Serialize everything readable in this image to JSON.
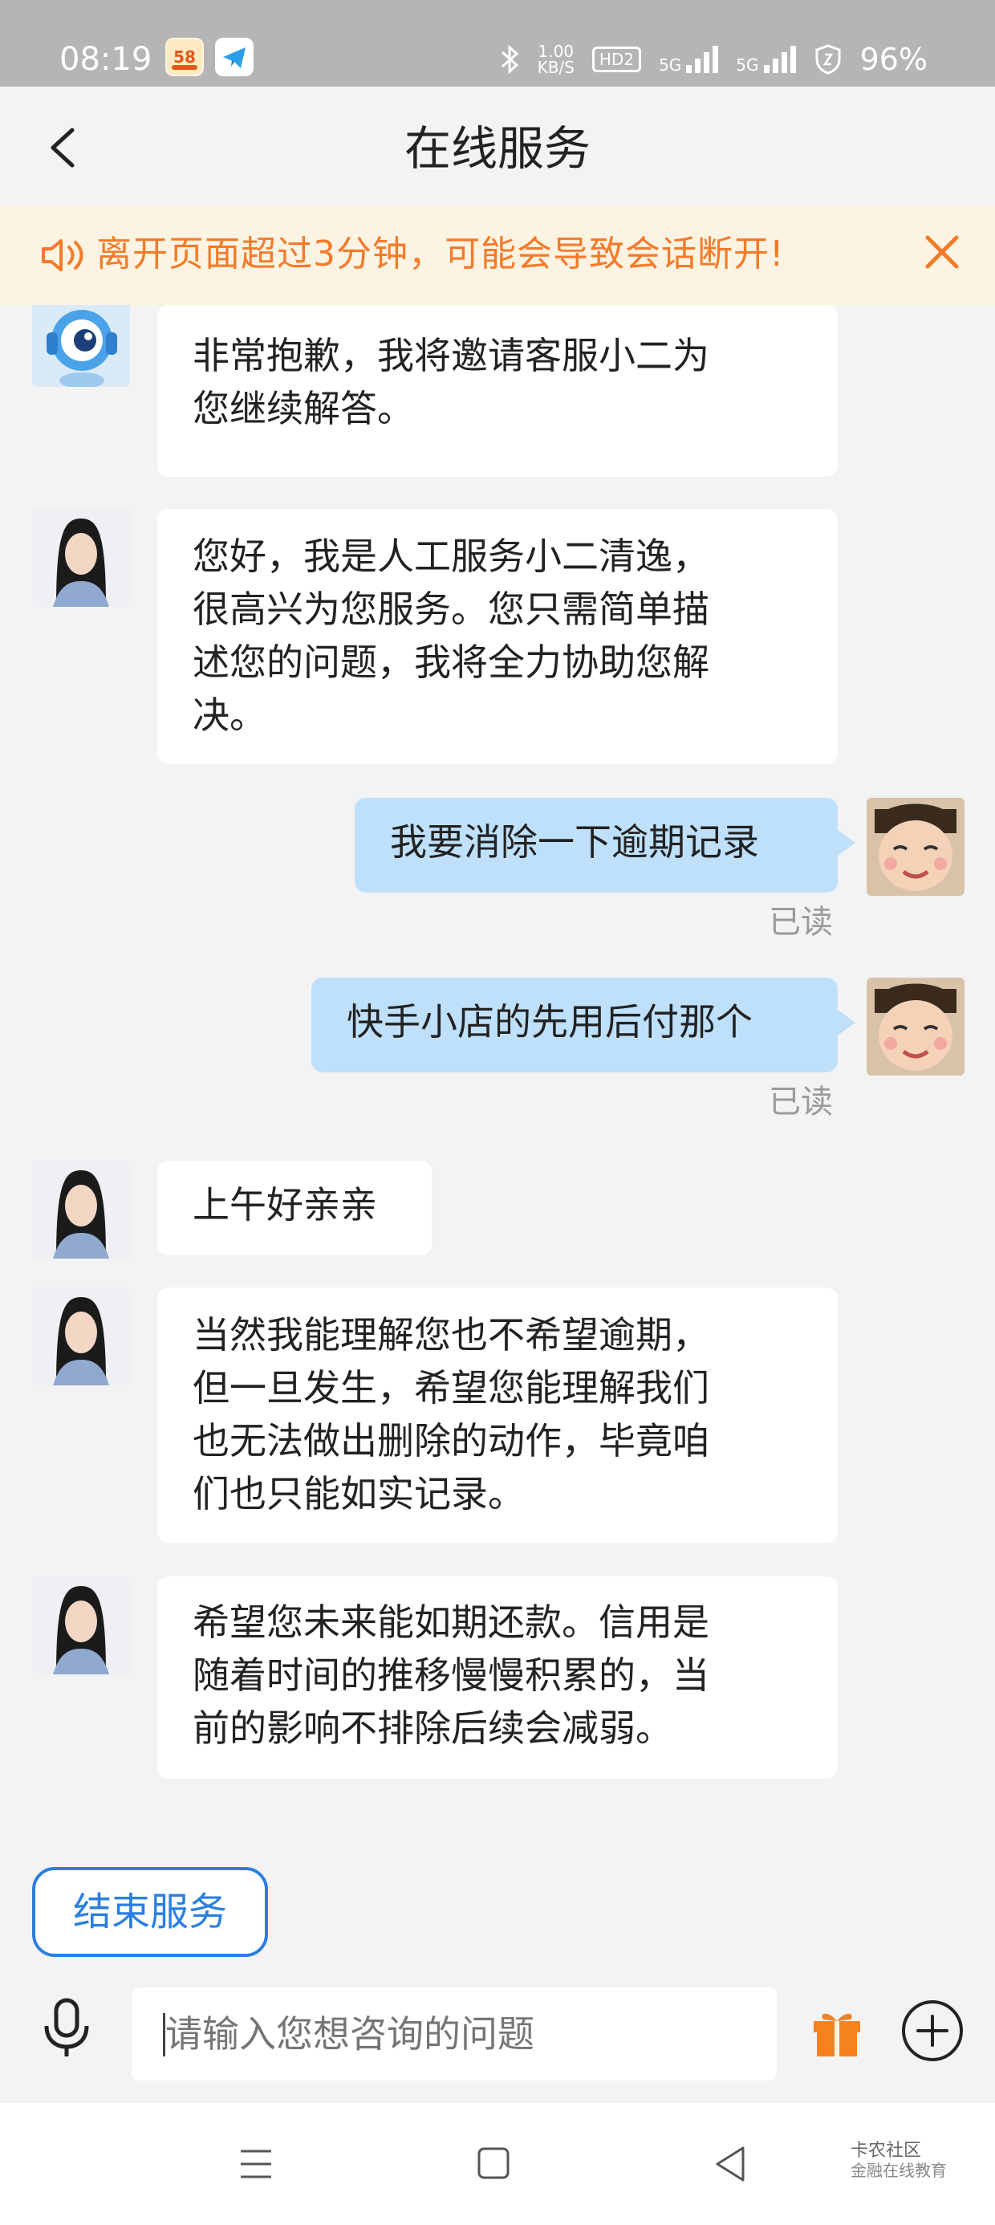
{
  "status_bar": {
    "time": "08:19",
    "net_speed_value": "1.00",
    "net_speed_unit": "KB/S",
    "hd_label": "HD2",
    "sim1_label": "5G",
    "sim2_label": "5G",
    "battery": "96%",
    "icons": [
      "58-app-icon",
      "telegram-icon",
      "bluetooth-icon",
      "signal-icon",
      "shield-icon"
    ]
  },
  "header": {
    "title": "在线服务",
    "back_icon": "chevron-left-icon"
  },
  "notice": {
    "text": "离开页面超过3分钟，可能会导致会话断开!",
    "icon": "speaker-icon",
    "close_icon": "close-icon",
    "color": "#f47a2a"
  },
  "messages": [
    {
      "side": "left",
      "avatar": "robot-avatar",
      "lines": [
        "非常抱歉，我将邀请客服小二为",
        "您继续解答。"
      ]
    },
    {
      "side": "left",
      "avatar": "agent-avatar",
      "lines": [
        "您好，我是人工服务小二清逸，",
        "很高兴为您服务。您只需简单描",
        "述您的问题，我将全力协助您解",
        "决。"
      ]
    },
    {
      "side": "right",
      "avatar": "user-avatar",
      "lines": [
        "我要消除一下逾期记录"
      ],
      "status": "已读"
    },
    {
      "side": "right",
      "avatar": "user-avatar",
      "lines": [
        "快手小店的先用后付那个"
      ],
      "status": "已读"
    },
    {
      "side": "left",
      "avatar": "agent-avatar",
      "lines": [
        "上午好亲亲"
      ]
    },
    {
      "side": "left",
      "avatar": "agent-avatar",
      "lines": [
        "当然我能理解您也不希望逾期，",
        "但一旦发生，希望您能理解我们",
        "也无法做出删除的动作，毕竟咱",
        "们也只能如实记录。"
      ]
    },
    {
      "side": "left",
      "avatar": "agent-avatar",
      "lines": [
        "希望您未来能如期还款。信用是",
        "随着时间的推移慢慢积累的，当",
        "前的影响不排除后续会减弱。"
      ]
    }
  ],
  "end_service": {
    "label": "结束服务",
    "color": "#2b7fe0"
  },
  "input_bar": {
    "placeholder": "请输入您想咨询的问题",
    "mic_icon": "microphone-icon",
    "gift_icon": "gift-icon",
    "plus_icon": "plus-circle-icon"
  },
  "nav_bar": {
    "icons": [
      "menu-icon",
      "home-square-icon",
      "back-triangle-icon"
    ],
    "watermark_line1": "卡农社区",
    "watermark_line2": "金融在线教育"
  },
  "colors": {
    "bubble_left": "#ffffff",
    "bubble_right": "#bfe0fb",
    "background": "#f3f3f3",
    "status_bar": "#b5b5b5"
  }
}
